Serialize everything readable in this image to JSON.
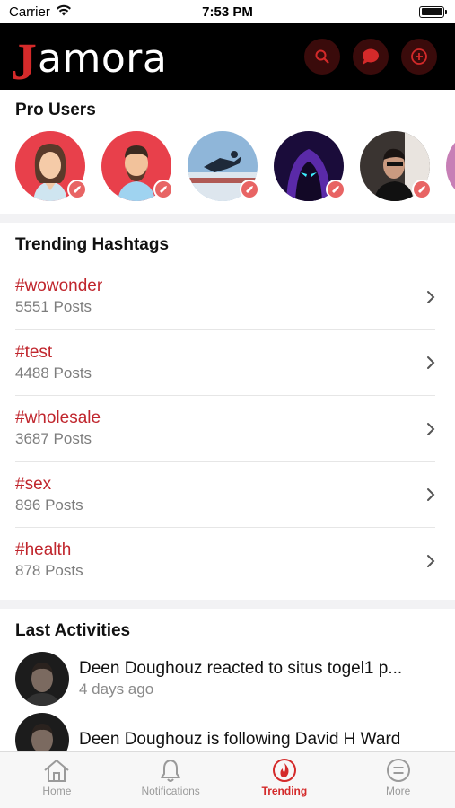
{
  "status": {
    "carrier": "Carrier",
    "time": "7:53 PM"
  },
  "app": {
    "logo_initial": "J",
    "logo_rest": "amora"
  },
  "header_icons": [
    "search-icon",
    "chat-icon",
    "add-icon"
  ],
  "pro_users": {
    "title": "Pro Users",
    "avatars": [
      "female-avatar",
      "male-avatar",
      "snowboarder-photo",
      "hooded-figure-photo",
      "man-photo",
      "partial-avatar"
    ]
  },
  "trending": {
    "title": "Trending Hashtags",
    "tags": [
      {
        "name": "#wowonder",
        "count": "5551 Posts"
      },
      {
        "name": "#test",
        "count": "4488 Posts"
      },
      {
        "name": "#wholesale",
        "count": "3687 Posts"
      },
      {
        "name": "#sex",
        "count": "896 Posts"
      },
      {
        "name": "#health",
        "count": "878 Posts"
      }
    ]
  },
  "activities": {
    "title": "Last Activities",
    "items": [
      {
        "text": "Deen Doughouz reacted to situs togel1 p...",
        "time": "4 days ago"
      },
      {
        "text": "Deen Doughouz is following David H Ward",
        "time": ""
      }
    ]
  },
  "tabs": [
    {
      "label": "Home",
      "icon": "home-icon"
    },
    {
      "label": "Notifications",
      "icon": "bell-icon"
    },
    {
      "label": "Trending",
      "icon": "flame-icon"
    },
    {
      "label": "More",
      "icon": "menu-circle-icon"
    }
  ],
  "colors": {
    "accent": "#c0262d",
    "header_bg": "#000000",
    "icon_button_bg": "#3a0b0b"
  }
}
